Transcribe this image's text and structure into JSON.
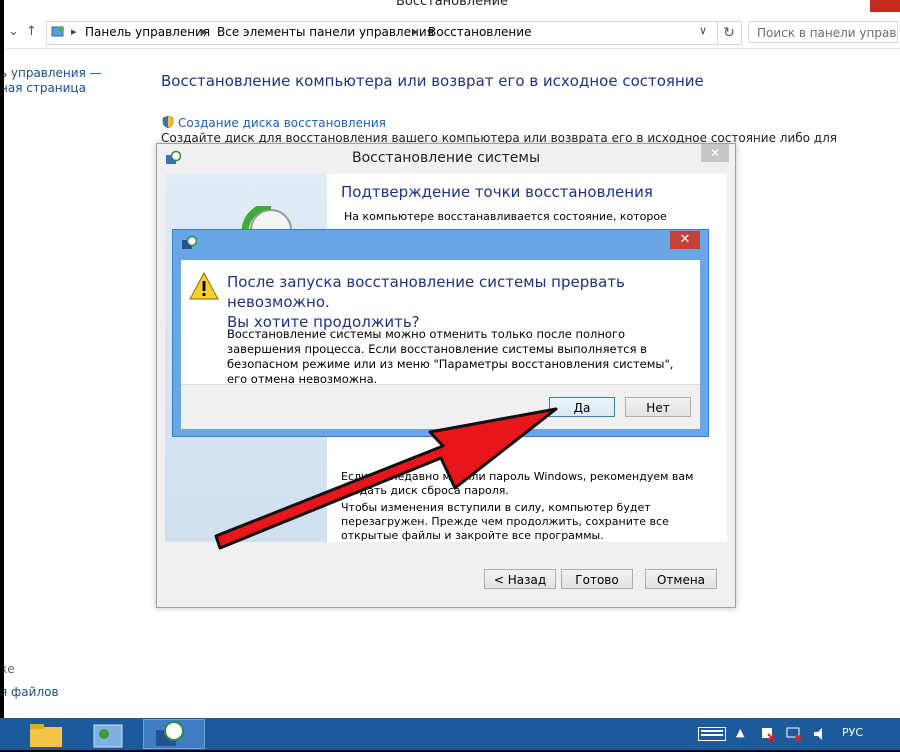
{
  "explorer": {
    "window_title": "Восстановление",
    "breadcrumbs": [
      "Панель управления",
      "Все элементы панели управления",
      "Восстановление"
    ],
    "search_placeholder": "Поиск в панели управления",
    "left_nav": {
      "home_line1": "ь управления —",
      "home_line2": "ная страница",
      "see_also": "ке",
      "file_history": "я файлов"
    },
    "heading": "Восстановление компьютера или возврат его в исходное состояние",
    "create_disk_link": "Создание диска восстановления",
    "create_disk_desc": "Создайте диск для восстановления вашего компьютера или возврата его в исходное состояние либо для"
  },
  "system_restore": {
    "title": "Восстановление системы",
    "heading": "Подтверждение точки восстановления",
    "text1": "На компьютере восстанавливается состояние, которое",
    "text2": "Если вы недавно меняли пароль Windows, рекомендуем вам создать диск сброса пароля.",
    "text3": "Чтобы изменения вступили в силу, компьютер будет перезагружен. Прежде чем продолжить, сохраните все открытые файлы и закройте все программы.",
    "buttons": {
      "back": "< Назад",
      "finish": "Готово",
      "cancel": "Отмена"
    }
  },
  "confirm_dialog": {
    "message_line1": "После запуска восстановление системы прервать невозможно.",
    "message_line2": "Вы хотите продолжить?",
    "body": "Восстановление системы можно отменить только после полного завершения процесса. Если восстановление системы выполняется в безопасном режиме или из меню \"Параметры восстановления системы\", его отмена невозможна.",
    "buttons": {
      "yes": "Да",
      "no": "Нет"
    }
  },
  "taskbar": {
    "language": "РУС"
  },
  "colors": {
    "taskbar": "#1c5a9c",
    "dialog_frame": "#6aa5e4",
    "heading_text": "#1e3287",
    "close_button": "#c6403a",
    "arrow": "#e8161b"
  },
  "icons": [
    "control-panel-icon",
    "shield-icon",
    "restore-icon",
    "warning-icon",
    "folder-icon",
    "explorer-icon",
    "keyboard-icon",
    "flag-icon",
    "volume-icon",
    "network-icon"
  ]
}
